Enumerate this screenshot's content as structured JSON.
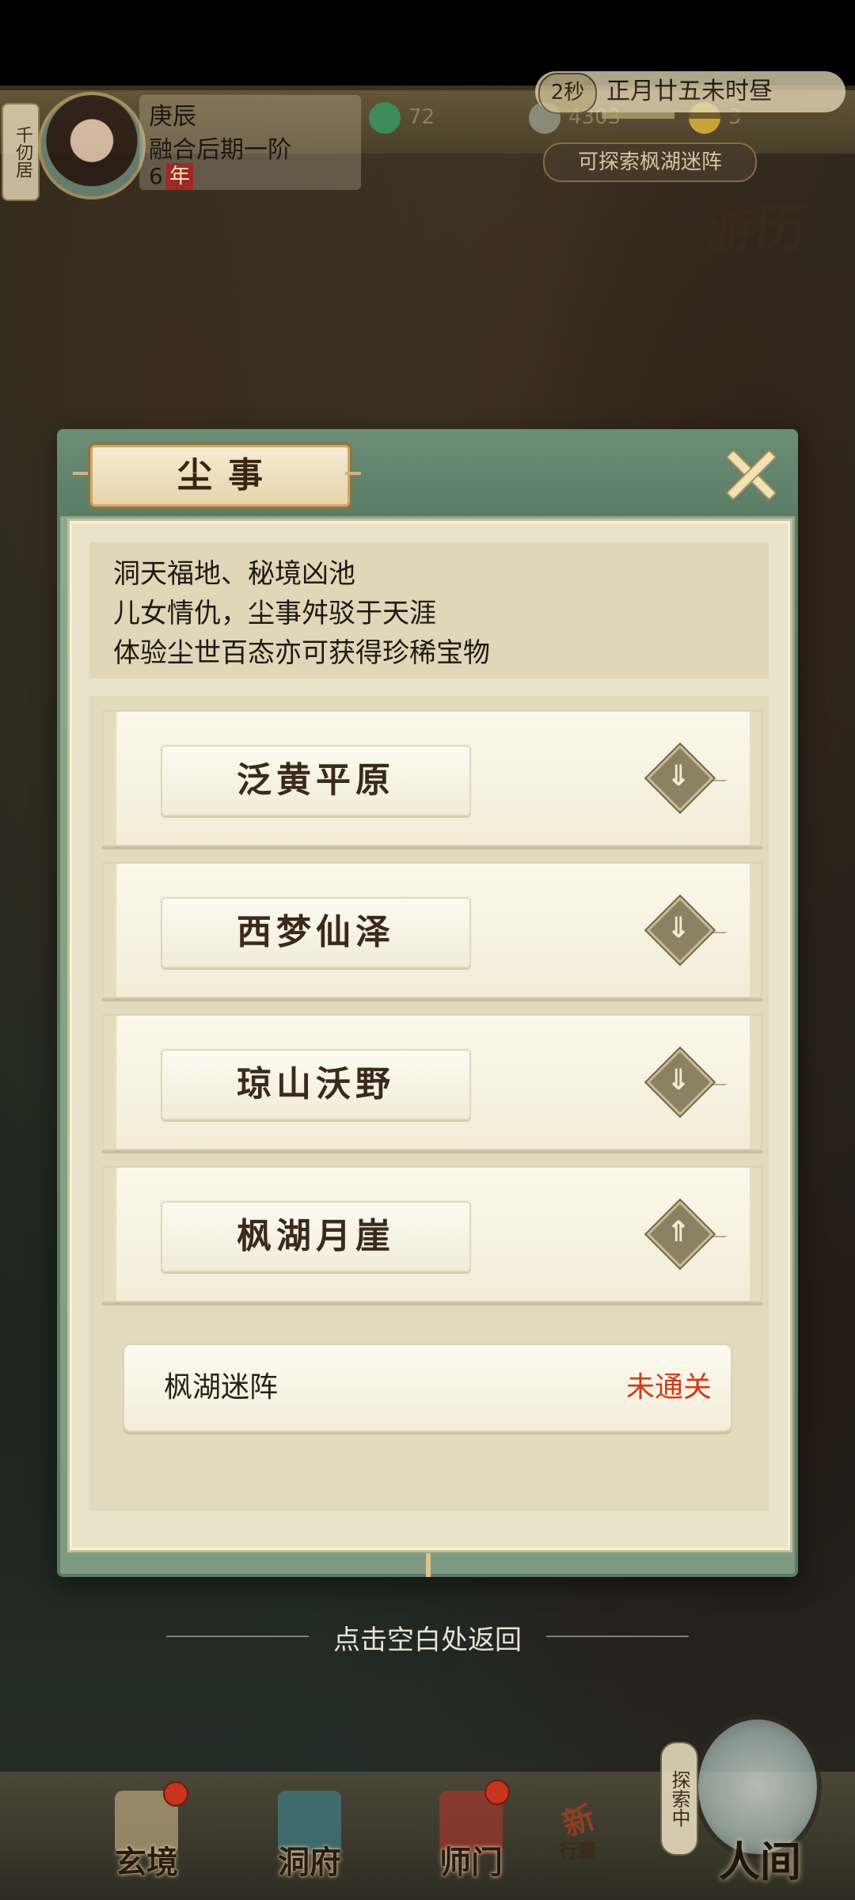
{
  "hud": {
    "residence": "千仞居",
    "player_name": "庚辰",
    "realm": "融合后期一阶",
    "age_value": "6",
    "age_unit": "年",
    "resources": [
      {
        "icon": "jade-coil-icon",
        "value": "72",
        "color": "#3f8a5a"
      },
      {
        "icon": "coin-icon",
        "value": "4303",
        "color": "#8a8a78"
      },
      {
        "icon": "gold-figure-icon",
        "value": "3",
        "color": "#c9a43a"
      }
    ],
    "time_seconds": "2秒",
    "calendar": "正月廿五未时昼",
    "time_progress": 0.3,
    "explore_hint": "可探索枫湖迷阵",
    "travel_label": "游历"
  },
  "panel": {
    "title": "尘事",
    "description": [
      "洞天福地、秘境凶池",
      "儿女情仇，尘事舛驳于天涯",
      "体验尘世百态亦可获得珍稀宝物"
    ],
    "regions": [
      {
        "name": "泛黄平原",
        "expanded": false,
        "arrow": "⇓"
      },
      {
        "name": "西梦仙泽",
        "expanded": false,
        "arrow": "⇓"
      },
      {
        "name": "琼山沃野",
        "expanded": false,
        "arrow": "⇓"
      },
      {
        "name": "枫湖月崖",
        "expanded": true,
        "arrow": "⇑"
      }
    ],
    "sub_items": [
      {
        "name": "枫湖迷阵",
        "status": "未通关",
        "status_color": "#d23a1a"
      }
    ]
  },
  "return_hint": "点击空白处返回",
  "bottom_nav": {
    "items": [
      {
        "label": "玄境"
      },
      {
        "label": "洞府"
      },
      {
        "label": "师门"
      }
    ],
    "bag_new": "新",
    "bag_label": "行囊",
    "exploring_tag": "探索中",
    "world_label": "人间"
  }
}
